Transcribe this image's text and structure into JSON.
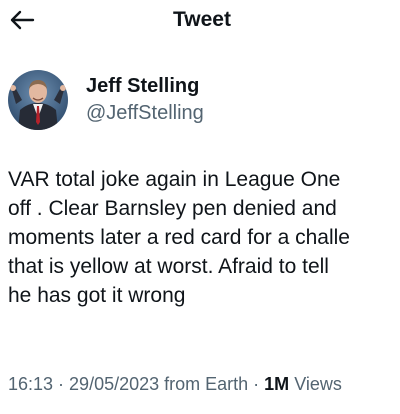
{
  "header": {
    "back_icon": "arrow-left-icon",
    "title": "Tweet"
  },
  "author": {
    "display_name": "Jeff Stelling",
    "handle": "@JeffStelling",
    "avatar_icon": "avatar-photo"
  },
  "tweet": {
    "lines": [
      "VAR total joke again in League One",
      "off . Clear Barnsley pen denied and",
      "moments later a red card for a challe",
      "that is yellow at worst. Afraid to tell",
      "he has got it wrong"
    ]
  },
  "meta": {
    "time": "16:13",
    "separator": " · ",
    "date": "29/05/2023",
    "source": " from Earth",
    "separator2": " · ",
    "views_count": "1M",
    "views_label": " Views"
  },
  "colors": {
    "text": "#0f1419",
    "secondary": "#536471",
    "background": "#ffffff"
  }
}
